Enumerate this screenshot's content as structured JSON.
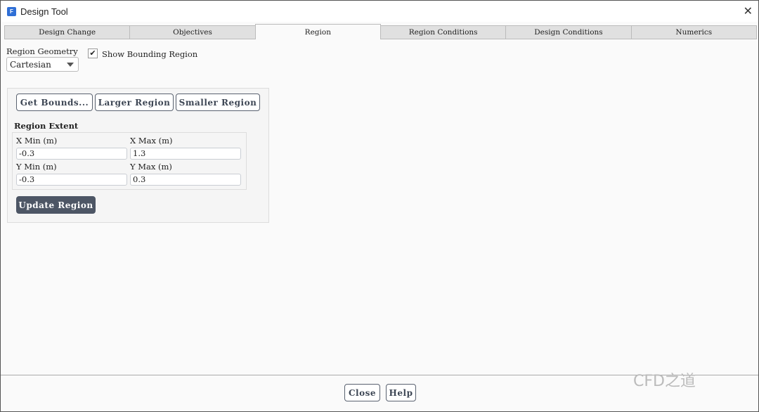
{
  "window": {
    "title": "Design Tool",
    "icon_letter": "F"
  },
  "tabs": [
    "Design Change",
    "Objectives",
    "Region",
    "Region Conditions",
    "Design Conditions",
    "Numerics"
  ],
  "active_tab": "Region",
  "region_geometry": {
    "label": "Region Geometry",
    "value": "Cartesian"
  },
  "show_bounding": {
    "label": "Show Bounding Region",
    "checked": true,
    "check": "✔"
  },
  "buttons": {
    "get_bounds": "Get Bounds...",
    "larger": "Larger Region",
    "smaller": "Smaller Region",
    "update": "Update Region",
    "close": "Close",
    "help": "Help"
  },
  "extent": {
    "title": "Region Extent",
    "x_min_label": "X Min (m)",
    "x_min": "-0.3",
    "x_max_label": "X Max (m)",
    "x_max": "1.3",
    "y_min_label": "Y Min (m)",
    "y_min": "-0.3",
    "y_max_label": "Y Max (m)",
    "y_max": "0.3"
  },
  "watermark": "CFD之道"
}
